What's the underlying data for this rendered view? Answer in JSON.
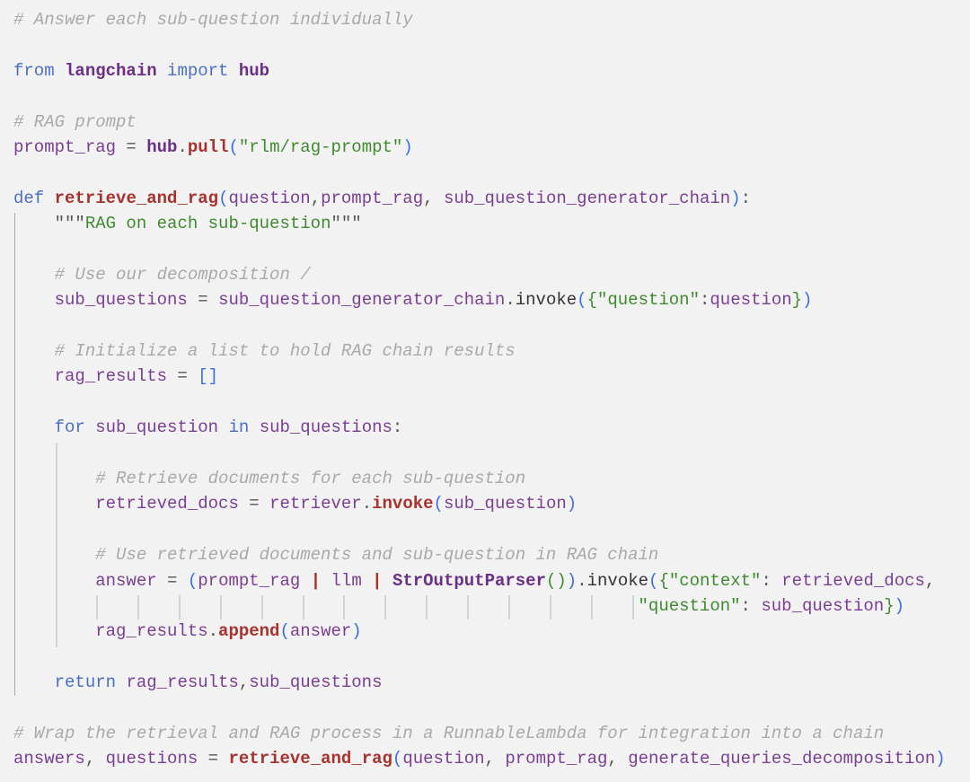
{
  "editor": {
    "background": "#f2f2f2",
    "colors": {
      "comment": "#a9a9a9",
      "keyword": "#4a6fc0",
      "identifier": "#7a3e92",
      "function": "#a8322d",
      "string": "#3f8a2e",
      "bracket_outer": "#3d6fe0",
      "bracket_inner": "#3f8a2e"
    },
    "lines": [
      {
        "tokens": [
          [
            "cm",
            "# Answer each sub-question individually"
          ]
        ]
      },
      {
        "tokens": []
      },
      {
        "tokens": [
          [
            "kw",
            "from"
          ],
          [
            "op",
            " "
          ],
          [
            "mod",
            "langchain"
          ],
          [
            "op",
            " "
          ],
          [
            "kw",
            "import"
          ],
          [
            "op",
            " "
          ],
          [
            "mod",
            "hub"
          ]
        ]
      },
      {
        "tokens": []
      },
      {
        "tokens": [
          [
            "cm",
            "# RAG prompt"
          ]
        ]
      },
      {
        "tokens": [
          [
            "id",
            "prompt_rag"
          ],
          [
            "op",
            " = "
          ],
          [
            "mod",
            "hub"
          ],
          [
            "op",
            "."
          ],
          [
            "fn",
            "pull"
          ],
          [
            "b1",
            "("
          ],
          [
            "st",
            "\"rlm/rag-prompt\""
          ],
          [
            "b1",
            ")"
          ]
        ]
      },
      {
        "tokens": []
      },
      {
        "tokens": [
          [
            "kw",
            "def"
          ],
          [
            "op",
            " "
          ],
          [
            "fn",
            "retrieve_and_rag"
          ],
          [
            "b1",
            "("
          ],
          [
            "id",
            "question"
          ],
          [
            "op",
            ","
          ],
          [
            "id",
            "prompt_rag"
          ],
          [
            "op",
            ", "
          ],
          [
            "id",
            "sub_question_generator_chain"
          ],
          [
            "b1",
            ")"
          ],
          [
            "op",
            ":"
          ]
        ]
      },
      {
        "tokens": [
          [
            "op",
            "    "
          ],
          [
            "op",
            "\"\"\""
          ],
          [
            "st",
            "RAG on each sub-question"
          ],
          [
            "op",
            "\"\"\""
          ]
        ]
      },
      {
        "tokens": []
      },
      {
        "tokens": [
          [
            "op",
            "    "
          ],
          [
            "cm",
            "# Use our decomposition /"
          ]
        ]
      },
      {
        "tokens": [
          [
            "op",
            "    "
          ],
          [
            "id",
            "sub_questions"
          ],
          [
            "op",
            " = "
          ],
          [
            "id",
            "sub_question_generator_chain"
          ],
          [
            "op",
            "."
          ],
          [
            "pl",
            "invoke"
          ],
          [
            "b1",
            "("
          ],
          [
            "b2",
            "{"
          ],
          [
            "st",
            "\"question\""
          ],
          [
            "op",
            ":"
          ],
          [
            "id",
            "question"
          ],
          [
            "b2",
            "}"
          ],
          [
            "b1",
            ")"
          ]
        ]
      },
      {
        "tokens": []
      },
      {
        "tokens": [
          [
            "op",
            "    "
          ],
          [
            "cm",
            "# Initialize a list to hold RAG chain results"
          ]
        ]
      },
      {
        "tokens": [
          [
            "op",
            "    "
          ],
          [
            "id",
            "rag_results"
          ],
          [
            "op",
            " = "
          ],
          [
            "b1",
            "[]"
          ]
        ]
      },
      {
        "tokens": []
      },
      {
        "tokens": [
          [
            "op",
            "    "
          ],
          [
            "kw",
            "for"
          ],
          [
            "op",
            " "
          ],
          [
            "id",
            "sub_question"
          ],
          [
            "op",
            " "
          ],
          [
            "kw",
            "in"
          ],
          [
            "op",
            " "
          ],
          [
            "id",
            "sub_questions"
          ],
          [
            "op",
            ":"
          ]
        ]
      },
      {
        "tokens": []
      },
      {
        "tokens": [
          [
            "op",
            "        "
          ],
          [
            "cm",
            "# Retrieve documents for each sub-question"
          ]
        ]
      },
      {
        "tokens": [
          [
            "op",
            "        "
          ],
          [
            "id",
            "retrieved_docs"
          ],
          [
            "op",
            " = "
          ],
          [
            "id",
            "retriever"
          ],
          [
            "op",
            "."
          ],
          [
            "fn",
            "invoke"
          ],
          [
            "b1",
            "("
          ],
          [
            "id",
            "sub_question"
          ],
          [
            "b1",
            ")"
          ]
        ]
      },
      {
        "tokens": []
      },
      {
        "tokens": [
          [
            "op",
            "        "
          ],
          [
            "cm",
            "# Use retrieved documents and sub-question in RAG chain"
          ]
        ]
      },
      {
        "tokens": [
          [
            "op",
            "        "
          ],
          [
            "id",
            "answer"
          ],
          [
            "op",
            " = "
          ],
          [
            "b1",
            "("
          ],
          [
            "id",
            "prompt_rag"
          ],
          [
            "op",
            " "
          ],
          [
            "pipe",
            "|"
          ],
          [
            "op",
            " "
          ],
          [
            "id",
            "llm"
          ],
          [
            "op",
            " "
          ],
          [
            "pipe",
            "|"
          ],
          [
            "op",
            " "
          ],
          [
            "mod",
            "StrOutputParser"
          ],
          [
            "b2",
            "()"
          ],
          [
            "b1",
            ")"
          ],
          [
            "op",
            "."
          ],
          [
            "pl",
            "invoke"
          ],
          [
            "b1",
            "("
          ],
          [
            "b2",
            "{"
          ],
          [
            "st",
            "\"context\""
          ],
          [
            "op",
            ": "
          ],
          [
            "id",
            "retrieved_docs"
          ],
          [
            "op",
            ","
          ]
        ]
      },
      {
        "tokens": [
          [
            "op",
            "                                                             "
          ],
          [
            "st",
            "\"question\""
          ],
          [
            "op",
            ": "
          ],
          [
            "id",
            "sub_question"
          ],
          [
            "b2",
            "}"
          ],
          [
            "b1",
            ")"
          ]
        ]
      },
      {
        "tokens": [
          [
            "op",
            "        "
          ],
          [
            "id",
            "rag_results"
          ],
          [
            "op",
            "."
          ],
          [
            "fn",
            "append"
          ],
          [
            "b1",
            "("
          ],
          [
            "id",
            "answer"
          ],
          [
            "b1",
            ")"
          ]
        ]
      },
      {
        "tokens": []
      },
      {
        "tokens": [
          [
            "op",
            "    "
          ],
          [
            "kw",
            "return"
          ],
          [
            "op",
            " "
          ],
          [
            "id",
            "rag_results"
          ],
          [
            "op",
            ","
          ],
          [
            "id",
            "sub_questions"
          ]
        ]
      },
      {
        "tokens": []
      },
      {
        "tokens": [
          [
            "cm",
            "# Wrap the retrieval and RAG process in a RunnableLambda for integration into a chain"
          ]
        ]
      },
      {
        "tokens": [
          [
            "id",
            "answers"
          ],
          [
            "op",
            ", "
          ],
          [
            "id",
            "questions"
          ],
          [
            "op",
            " = "
          ],
          [
            "fn",
            "retrieve_and_rag"
          ],
          [
            "b1",
            "("
          ],
          [
            "id",
            "question"
          ],
          [
            "op",
            ", "
          ],
          [
            "id",
            "prompt_rag"
          ],
          [
            "op",
            ", "
          ],
          [
            "id",
            "generate_queries_decomposition"
          ],
          [
            "b1",
            ")"
          ]
        ]
      }
    ]
  }
}
